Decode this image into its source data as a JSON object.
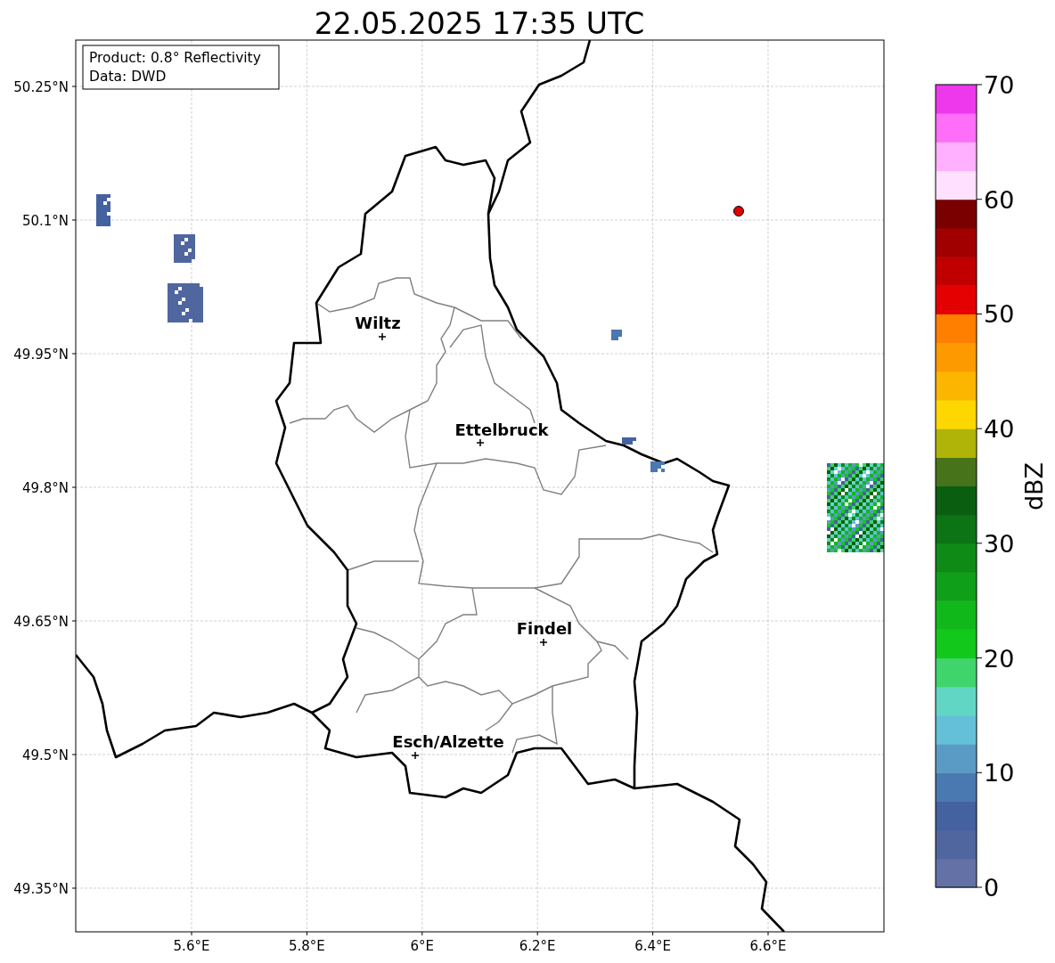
{
  "title": "22.05.2025 17:35 UTC",
  "info_box": [
    "Product: 0.8° Reflectivity",
    "Data: DWD"
  ],
  "lat_ticks": [
    "50.25°N",
    "50.1°N",
    "49.95°N",
    "49.8°N",
    "49.65°N",
    "49.5°N",
    "49.35°N"
  ],
  "lon_ticks": [
    "5.6°E",
    "5.8°E",
    "6°E",
    "6.2°E",
    "6.4°E",
    "6.6°E"
  ],
  "cities": [
    {
      "name": "Wiltz"
    },
    {
      "name": "Ettelbruck"
    },
    {
      "name": "Findel"
    },
    {
      "name": "Esch/Alzette"
    }
  ],
  "colorbar": {
    "label": "dBZ",
    "ticks": [
      "70",
      "60",
      "50",
      "40",
      "30",
      "20",
      "10",
      "0"
    ],
    "segments": [
      {
        "color": "#6371a6"
      },
      {
        "color": "#50669f"
      },
      {
        "color": "#4461a0"
      },
      {
        "color": "#4a78b0"
      },
      {
        "color": "#5a9bc5"
      },
      {
        "color": "#64c0d8"
      },
      {
        "color": "#62d6c4"
      },
      {
        "color": "#40d46c"
      },
      {
        "color": "#12c81a"
      },
      {
        "color": "#10b81a"
      },
      {
        "color": "#109f18"
      },
      {
        "color": "#0e8a17"
      },
      {
        "color": "#0c7414"
      },
      {
        "color": "#0a5e10"
      },
      {
        "color": "#47731a"
      },
      {
        "color": "#b0b408"
      },
      {
        "color": "#ffd700"
      },
      {
        "color": "#fdb600"
      },
      {
        "color": "#fd9a00"
      },
      {
        "color": "#ff7f00"
      },
      {
        "color": "#e40000"
      },
      {
        "color": "#c00000"
      },
      {
        "color": "#a00000"
      },
      {
        "color": "#7a0000"
      },
      {
        "color": "#ffe0ff"
      },
      {
        "color": "#ffb0ff"
      },
      {
        "color": "#ff6ef8"
      },
      {
        "color": "#ee38ec"
      }
    ]
  }
}
